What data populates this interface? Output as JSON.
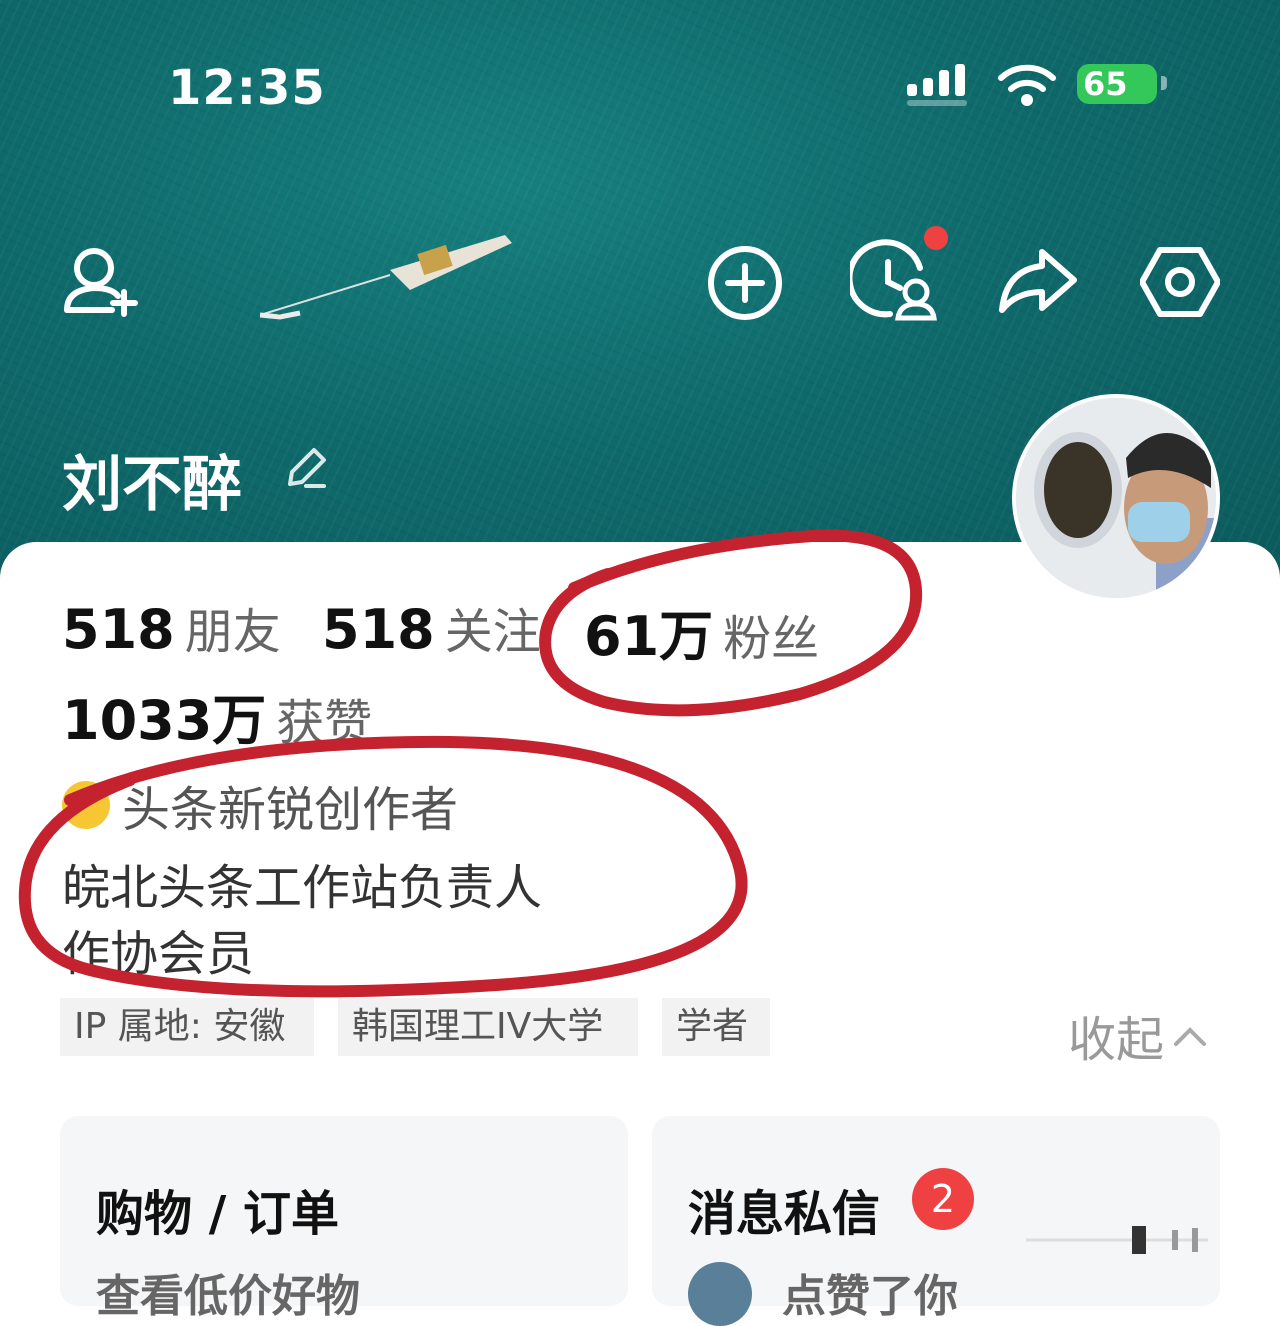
{
  "status_bar": {
    "time": "12:35",
    "battery": "65"
  },
  "profile": {
    "name": "刘不醉",
    "stats": [
      {
        "value": "518",
        "label": "朋友"
      },
      {
        "value": "518",
        "label": "关注"
      },
      {
        "value": "61万",
        "label": "粉丝"
      },
      {
        "value": "1033万",
        "label": "获赞"
      }
    ],
    "badge": "头条新锐创作者",
    "bio_lines": [
      "皖北头条工作站负责人",
      "作协会员"
    ],
    "tags": [
      "IP 属地: 安徽",
      "韩国理工IV大学",
      "学者"
    ],
    "collapse_label": "收起"
  },
  "panels": {
    "shopping": {
      "title": "购物 / 订单",
      "subtitle": "查看低价好物"
    },
    "messages": {
      "title": "消息私信",
      "count": "2",
      "subtitle": "点赞了你"
    }
  },
  "colors": {
    "hero_teal": "#0f6a6b",
    "annotation_red": "#c4222e",
    "badge_red": "#f04142",
    "battery_green": "#34c759"
  },
  "icons": [
    "add-friend-icon",
    "plus-circle-icon",
    "history-icon",
    "share-icon",
    "settings-icon",
    "edit-icon",
    "chevron-up-icon",
    "wifi-icon",
    "signal-icon"
  ]
}
